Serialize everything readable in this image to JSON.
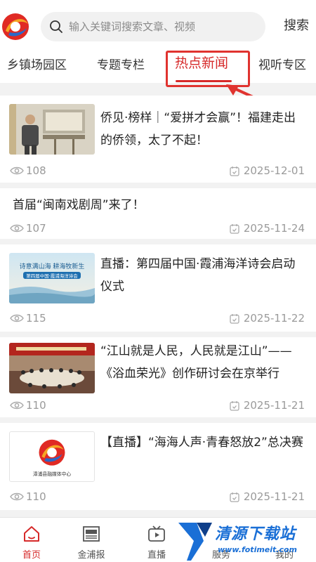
{
  "header": {
    "search_placeholder": "输入关键词搜索文章、视频",
    "search_button": "搜索"
  },
  "tabs": [
    {
      "label": "乡镇场园区"
    },
    {
      "label": "专题专栏"
    },
    {
      "label": "热点新闻"
    },
    {
      "label": "视听专区"
    }
  ],
  "active_tab": "热点新闻",
  "feed": [
    {
      "title": "侨见·榜样｜“爱拼才会赢”！福建走出的侨领，太了不起！",
      "views": "108",
      "date": "2025-12-01"
    },
    {
      "title": "首届“闽南戏剧周”来了！",
      "views": "107",
      "date": "2025-11-24"
    },
    {
      "title": "直播：第四届中国·霞浦海洋诗会启动仪式",
      "views": "115",
      "date": "2025-11-22"
    },
    {
      "title": "“江山就是人民，人民就是江山”——《浴血荣光》创作研讨会在京举行",
      "views": "110",
      "date": "2025-11-21"
    },
    {
      "title": "【直播】“海海人声·青春怒放2”总决赛",
      "views": "110",
      "date": "2025-11-21"
    }
  ],
  "thumb_text": {
    "poster_line1": "诗意满山海  耕海牧新生",
    "poster_line2": "第四届中国·霞浦海洋诗会",
    "logo_caption": "漳浦县融媒体中心"
  },
  "bottom_nav": [
    {
      "label": "首页"
    },
    {
      "label": "金浦报"
    },
    {
      "label": "直播"
    },
    {
      "label": "服务"
    },
    {
      "label": "我的"
    }
  ],
  "watermark": {
    "text": "清源下载站",
    "url": "www.fotimeit.com"
  },
  "colors": {
    "accent": "#d62a2a",
    "meta": "#9a9a9a",
    "watermark": "#1a6fd6"
  }
}
